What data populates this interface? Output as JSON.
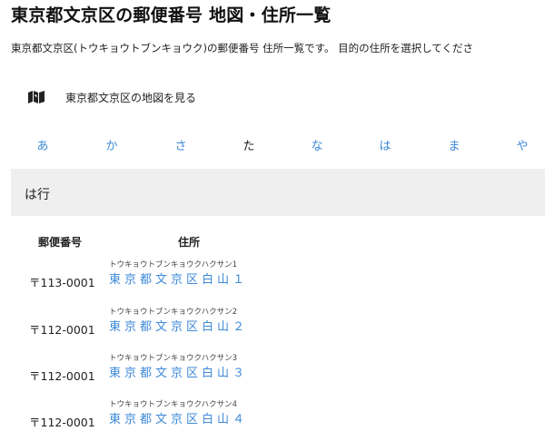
{
  "page": {
    "title": "東京都文京区の郵便番号 地図・住所一覧",
    "description": "東京都文京区(トウキョウトブンキョウク)の郵便番号 住所一覧です。 目的の住所を選択してくださ"
  },
  "map_link": {
    "label": "東京都文京区の地図を見る",
    "icon": "map-icon"
  },
  "kana_nav": [
    {
      "label": "あ",
      "link": true
    },
    {
      "label": "か",
      "link": true
    },
    {
      "label": "さ",
      "link": true
    },
    {
      "label": "た",
      "link": false
    },
    {
      "label": "な",
      "link": true
    },
    {
      "label": "は",
      "link": true
    },
    {
      "label": "ま",
      "link": true
    },
    {
      "label": "や",
      "link": true
    }
  ],
  "section": {
    "title": "は行"
  },
  "table": {
    "headers": {
      "postal": "郵便番号",
      "address": "住所"
    },
    "rows": [
      {
        "postal": "〒113-0001",
        "reading": "トウキョウトブンキョウクハクサン1",
        "address": "東京都文京区白山１"
      },
      {
        "postal": "〒112-0001",
        "reading": "トウキョウトブンキョウクハクサン2",
        "address": "東京都文京区白山２"
      },
      {
        "postal": "〒112-0001",
        "reading": "トウキョウトブンキョウクハクサン3",
        "address": "東京都文京区白山３"
      },
      {
        "postal": "〒112-0001",
        "reading": "トウキョウトブンキョウクハクサン4",
        "address": "東京都文京区白山４"
      }
    ]
  },
  "colors": {
    "link": "#3d8ad8",
    "section_bg": "#efefef",
    "text": "#222222"
  }
}
